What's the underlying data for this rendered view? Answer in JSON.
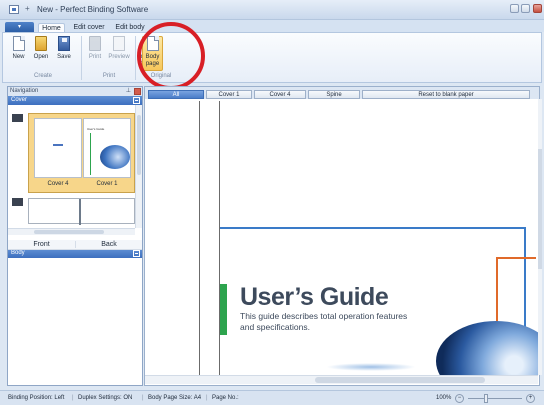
{
  "window": {
    "title_prefix": "+",
    "title": "New - Perfect Binding Software"
  },
  "ribbon": {
    "file_tab": "▾",
    "tabs": [
      {
        "label": "Home"
      },
      {
        "label": "Edit cover"
      },
      {
        "label": "Edit body"
      },
      {
        "label": "..."
      }
    ],
    "groups": {
      "create": {
        "label": "Create",
        "buttons": [
          {
            "label": "New"
          },
          {
            "label": "Open"
          },
          {
            "label": "Save"
          }
        ]
      },
      "print": {
        "label": "Print",
        "buttons": [
          {
            "label": "Print"
          },
          {
            "label": "Preview"
          }
        ]
      },
      "original": {
        "label": "Original",
        "cover_line1": "over",
        "cover_line2": "ige",
        "body_line1": "Body",
        "body_line2": "page"
      }
    }
  },
  "navigation": {
    "title": "Navigation",
    "cover_section": "Cover",
    "thumbnail": {
      "left_label": "Cover 4",
      "right_label": "Cover 1",
      "right_text": "User's Guide"
    },
    "body_section": "Body",
    "body_columns": [
      "Front",
      "Back"
    ]
  },
  "viewer": {
    "buttons": [
      "All",
      "Cover 1",
      "Cover 4",
      "Spine",
      "Reset to blank paper"
    ],
    "page_title": "User’s Guide",
    "page_subtitle_line1": "This guide describes total operation features",
    "page_subtitle_line2": "and specifications."
  },
  "status": {
    "binding": "Binding Position: Left",
    "duplex": "Duplex Settings: ON",
    "pagesize": "Body Page Size: A4",
    "pageno": "Page No.:",
    "zoom": "100%"
  },
  "colors": {
    "accent": "#3d6fbf",
    "highlight_ring": "#d81f26",
    "doc_green": "#2da44e",
    "doc_blue": "#3a7bc8",
    "doc_orange": "#e06a2a"
  }
}
